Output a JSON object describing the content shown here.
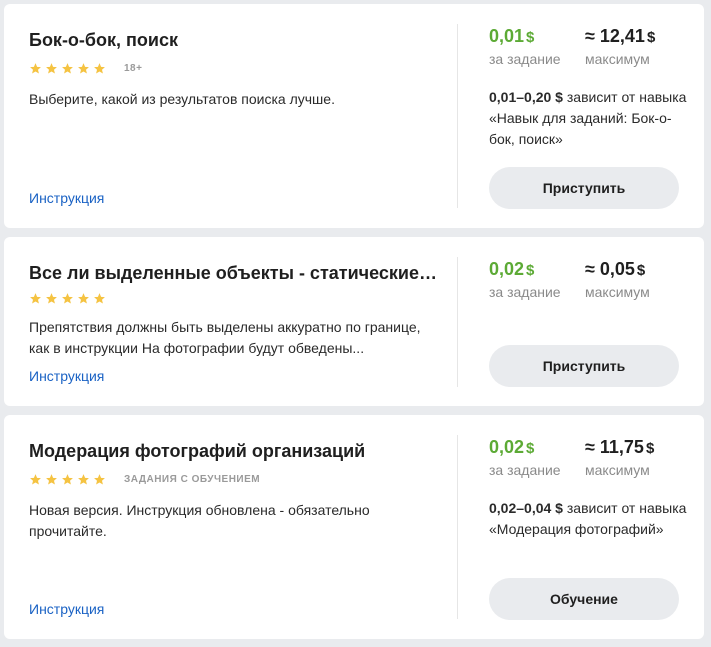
{
  "tasks": [
    {
      "title": "Бок-о-бок, поиск",
      "stars": 5,
      "badge": "18+",
      "description": "Выберите, какой из результатов поиска лучше.",
      "instruction_link": "Инструкция",
      "price": "0,01",
      "price_currency": "$",
      "price_label": "за задание",
      "max": "≈ 12,41",
      "max_currency": "$",
      "max_label": "максимум",
      "depends_range": "0,01–0,20 $",
      "depends_text": " зависит от навыка «Навык для заданий: Бок-о-бок, поиск»",
      "button": "Приступить"
    },
    {
      "title": "Все ли выделенные объекты - статические п...",
      "stars": 5,
      "badge": "",
      "description": "Препятствия должны быть выделены аккуратно по границе, как в инструкции На фотографии будут обведены...",
      "instruction_link": "Инструкция",
      "price": "0,02",
      "price_currency": "$",
      "price_label": "за задание",
      "max": "≈ 0,05",
      "max_currency": "$",
      "max_label": "максимум",
      "depends_range": "",
      "depends_text": "",
      "button": "Приступить"
    },
    {
      "title": "Модерация фотографий организаций",
      "stars": 5,
      "badge": "ЗАДАНИЯ С ОБУЧЕНИЕМ",
      "description": "Новая версия. Инструкция обновлена - обязательно прочитайте.",
      "instruction_link": "Инструкция",
      "price": "0,02",
      "price_currency": "$",
      "price_label": "за задание",
      "max": "≈ 11,75",
      "max_currency": "$",
      "max_label": "максимум",
      "depends_range": "0,02–0,04 $",
      "depends_text": " зависит от навыка «Модерация фотографий»",
      "button": "Обучение"
    }
  ],
  "colors": {
    "price_green": "#5caa35",
    "link_blue": "#1a62c4",
    "star_yellow": "#f5c342",
    "button_bg": "#e9ebee"
  },
  "icons": {
    "rating": "star-icon"
  }
}
